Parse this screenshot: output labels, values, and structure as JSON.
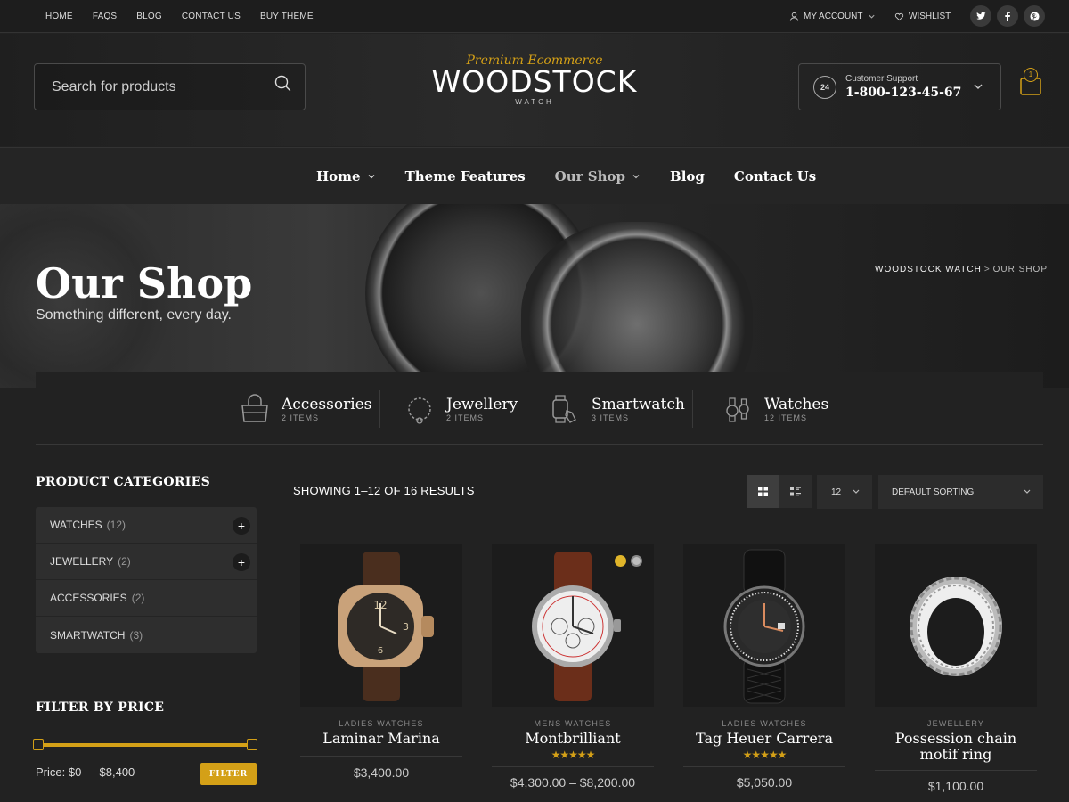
{
  "topbar": {
    "links": [
      "HOME",
      "FAQS",
      "BLOG",
      "CONTACT US",
      "BUY THEME"
    ],
    "account": "MY ACCOUNT",
    "wishlist": "WISHLIST",
    "social": [
      "twitter-icon",
      "facebook-icon",
      "pinterest-icon"
    ]
  },
  "header": {
    "search_placeholder": "Search for products",
    "logo_tagline": "Premium Ecommerce",
    "logo_brand": "WOODSTOCK",
    "logo_sub": "WATCH",
    "support_label": "Customer Support",
    "support_phone": "1-800-123-45-67",
    "support_icon_text": "24",
    "cart_count": "1"
  },
  "nav": {
    "items": [
      "Home",
      "Theme Features",
      "Our Shop",
      "Blog",
      "Contact Us"
    ]
  },
  "hero": {
    "title": "Our Shop",
    "subtitle": "Something different, every day.",
    "breadcrumb_root": "WOODSTOCK WATCH",
    "breadcrumb_sep": ">",
    "breadcrumb_current": "OUR SHOP"
  },
  "categories": [
    {
      "title": "Accessories",
      "count": "2 ITEMS",
      "icon": "bag-icon"
    },
    {
      "title": "Jewellery",
      "count": "2 ITEMS",
      "icon": "necklace-icon"
    },
    {
      "title": "Smartwatch",
      "count": "3 ITEMS",
      "icon": "smartwatch-icon"
    },
    {
      "title": "Watches",
      "count": "12 ITEMS",
      "icon": "watch-icon"
    }
  ],
  "sidebar": {
    "categories_heading": "PRODUCT CATEGORIES",
    "list": [
      {
        "label": "WATCHES",
        "count": "(12)",
        "expandable": true
      },
      {
        "label": "JEWELLERY",
        "count": "(2)",
        "expandable": true
      },
      {
        "label": "ACCESSORIES",
        "count": "(2)",
        "expandable": false
      },
      {
        "label": "SMARTWATCH",
        "count": "(3)",
        "expandable": false
      }
    ],
    "price_heading": "FILTER BY PRICE",
    "price_label": "Price: $0 — $8,400",
    "filter_button": "FILTER",
    "price_range": {
      "min": 0,
      "max": 8400,
      "selected_min": 0,
      "selected_max": 8400
    }
  },
  "toolbar": {
    "showing": "SHOWING 1–12 OF 16 RESULTS",
    "per_page": "12",
    "sort": "DEFAULT SORTING",
    "view": "grid"
  },
  "products": [
    {
      "category": "LADIES WATCHES",
      "name": "Laminar Marina",
      "price": "$3,400.00",
      "rating": null
    },
    {
      "category": "MENS WATCHES",
      "name": "Montbrilliant",
      "price": "$4,300.00 – $8,200.00",
      "rating": "★★★★★",
      "swatches": [
        "#e0b52a",
        "#bdbdbd"
      ]
    },
    {
      "category": "LADIES WATCHES",
      "name": "Tag Heuer Carrera",
      "price": "$5,050.00",
      "rating": "★★★★★"
    },
    {
      "category": "JEWELLERY",
      "name": "Possession chain motif ring",
      "price": "$1,100.00",
      "rating": null
    }
  ],
  "colors": {
    "accent": "#d4a017",
    "background": "#222222"
  }
}
